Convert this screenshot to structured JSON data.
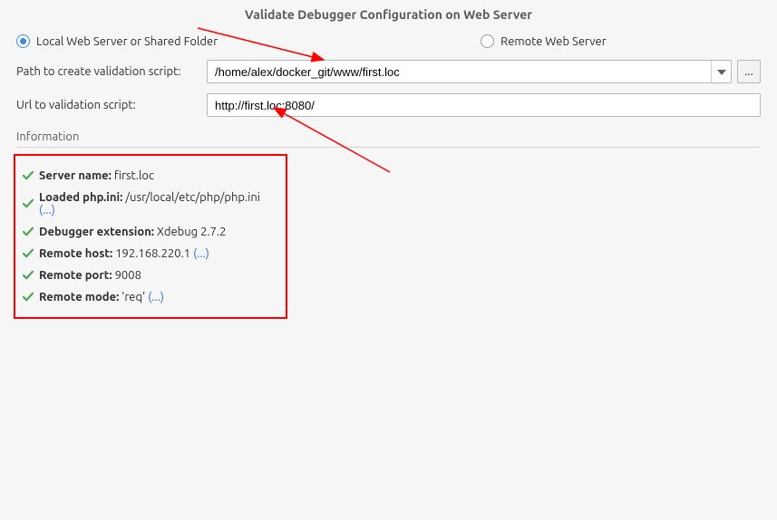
{
  "title": "Validate Debugger Configuration on Web Server",
  "radios": {
    "local": "Local Web Server or Shared Folder",
    "remote": "Remote Web Server"
  },
  "form": {
    "pathLabel": "Path to create validation script:",
    "pathValue": "/home/alex/docker_git/www/first.loc",
    "urlLabel": "Url to validation script:",
    "urlValue": "http://first.loc:8080/",
    "dots": "..."
  },
  "info": {
    "heading": "Information",
    "items": [
      {
        "key": "Server name:",
        "value": " first.loc",
        "link": ""
      },
      {
        "key": "Loaded php.ini:",
        "value": " /usr/local/etc/php/php.ini ",
        "link": "(...)"
      },
      {
        "key": "Debugger extension:",
        "value": " Xdebug 2.7.2",
        "link": ""
      },
      {
        "key": "Remote host:",
        "value": " 192.168.220.1 ",
        "link": "(...)"
      },
      {
        "key": "Remote port:",
        "value": " 9008",
        "link": ""
      },
      {
        "key": "Remote mode:",
        "value": " 'req' ",
        "link": "(...)"
      }
    ]
  }
}
